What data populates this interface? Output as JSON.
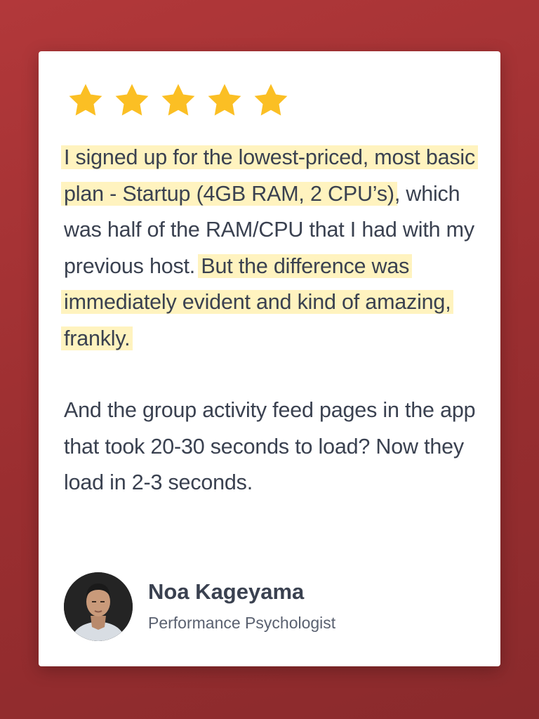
{
  "rating": {
    "stars": 5,
    "max": 5,
    "star_color": "#fbbf24",
    "icon": "star-icon"
  },
  "quote": {
    "p1_seg1": "I signed up for the lowest-priced, most basic plan - Startup (4GB RAM, 2 CPU’s)",
    "p1_seg2": ", which was half of the RAM/CPU that I had with my previous host. ",
    "p1_seg3": "But the difference was immediately evident and kind of amazing, frankly.",
    "p2": "And the group activity feed pages in the app that took 20-30 seconds to load? Now they load in 2-3 seconds."
  },
  "author": {
    "name": "Noa Kageyama",
    "title": "Performance Psychologist",
    "avatar": "avatar-photo"
  },
  "colors": {
    "background": "#a83436",
    "card": "#ffffff",
    "highlight": "#fff3bf",
    "text": "#3a4150"
  }
}
